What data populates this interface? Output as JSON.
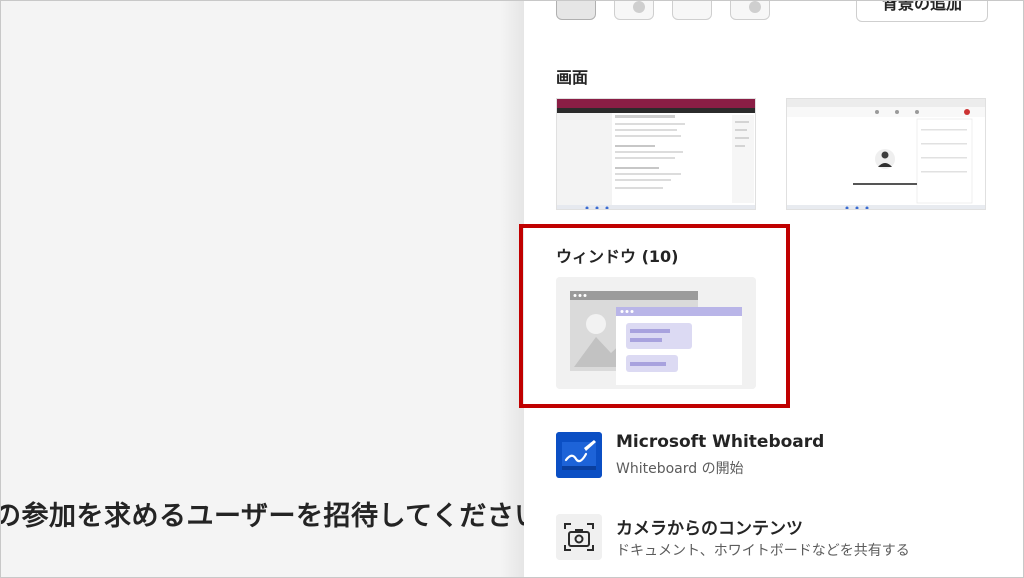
{
  "background_section": {
    "add_button_label": "背景の追加"
  },
  "screen_section": {
    "title": "画面"
  },
  "window_section": {
    "title": "ウィンドウ (10)"
  },
  "apps": [
    {
      "title": "Microsoft Whiteboard",
      "subtitle": "Whiteboard の開始",
      "icon": "whiteboard-icon"
    },
    {
      "title": "カメラからのコンテンツ",
      "subtitle": "ドキュメント、ホワイトボードなどを共有する",
      "icon": "camera-icon"
    }
  ],
  "left_pane": {
    "invite_text": "の参加を求めるユーザーを招待してください"
  },
  "colors": {
    "highlight": "#c00000",
    "whiteboard_brand": "#0b4fc4",
    "window_accent": "#b5b0e6"
  }
}
